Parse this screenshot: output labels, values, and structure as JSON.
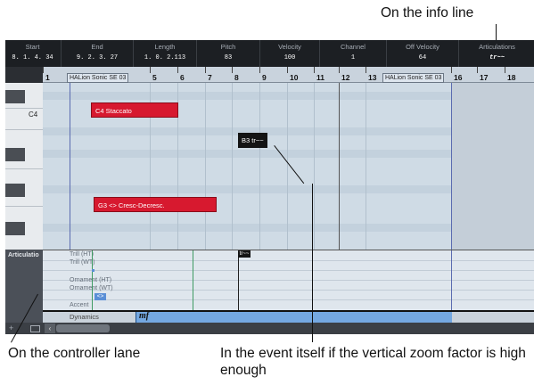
{
  "callouts": {
    "info_line": "On the info line",
    "controller_lane": "On the controller lane",
    "event_itself": "In the event itself if the vertical zoom factor is high enough"
  },
  "info_line": {
    "start": {
      "label": "Start",
      "value": "8. 1. 4. 34"
    },
    "end": {
      "label": "End",
      "value": "9. 2. 3. 27"
    },
    "length": {
      "label": "Length",
      "value": "1. 0. 2.113"
    },
    "pitch": {
      "label": "Pitch",
      "value": "83"
    },
    "velocity": {
      "label": "Velocity",
      "value": "100"
    },
    "channel": {
      "label": "Channel",
      "value": "1"
    },
    "off_velocity": {
      "label": "Off Velocity",
      "value": "64"
    },
    "articulations": {
      "label": "Articulations",
      "value": "tr~~"
    }
  },
  "ruler": {
    "bars": [
      "1",
      "5",
      "6",
      "7",
      "8",
      "9",
      "10",
      "11",
      "12",
      "13",
      "16",
      "17",
      "18"
    ],
    "instrument_left": "HALion Sonic SE 03",
    "instrument_right": "HALion Sonic SE 03"
  },
  "keyboard": {
    "c4_label": "C4"
  },
  "notes": {
    "staccato": "C4 Staccato",
    "trill_tag": "B3 tr~~",
    "cresc": "G3 <> Cresc-Decresc."
  },
  "controller_lane": {
    "lane_label": "Articulatio",
    "articulations": [
      "Trill (HT)",
      "Trill (WT)",
      "Ornament (HT)",
      "Ornament (WT)",
      "Accent"
    ],
    "marker_label": "<>",
    "trill_marker": "tr~~",
    "dynamics_label": "Dynamics",
    "dynamics_symbol": "mf"
  },
  "colors": {
    "note_red": "#d7192f",
    "dynamics_blue": "#74a8e1",
    "lane_marker_blue": "#5b8fd6"
  }
}
